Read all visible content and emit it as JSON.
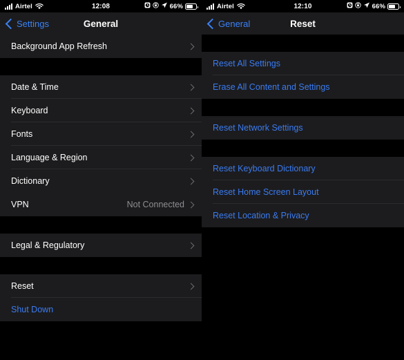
{
  "panels": [
    {
      "id": "general",
      "status_bar": {
        "carrier": "Airtel",
        "time": "12:08",
        "battery_percent": "66%",
        "signal_icon": "cellular-signal-icon",
        "wifi_icon": "wifi-icon",
        "alarm_icon": "alarm-clock-icon",
        "rotation_lock_icon": "rotation-lock-icon",
        "location_icon": "location-arrow-icon",
        "battery_icon": "battery-icon"
      },
      "nav": {
        "back_label": "Settings",
        "title": "General",
        "back_icon": "chevron-left-icon"
      },
      "groups": [
        {
          "rows": [
            {
              "label": "Background App Refresh",
              "detail": "",
              "chevron": true,
              "style": "default"
            }
          ]
        },
        {
          "rows": [
            {
              "label": "Date & Time",
              "detail": "",
              "chevron": true,
              "style": "default"
            },
            {
              "label": "Keyboard",
              "detail": "",
              "chevron": true,
              "style": "default"
            },
            {
              "label": "Fonts",
              "detail": "",
              "chevron": true,
              "style": "default"
            },
            {
              "label": "Language & Region",
              "detail": "",
              "chevron": true,
              "style": "default"
            },
            {
              "label": "Dictionary",
              "detail": "",
              "chevron": true,
              "style": "default"
            }
          ]
        },
        {
          "rows": [
            {
              "label": "VPN",
              "detail": "Not Connected",
              "chevron": true,
              "style": "default"
            }
          ]
        },
        {
          "rows": [
            {
              "label": "Legal & Regulatory",
              "detail": "",
              "chevron": true,
              "style": "default"
            }
          ]
        },
        {
          "rows": [
            {
              "label": "Reset",
              "detail": "",
              "chevron": true,
              "style": "default"
            },
            {
              "label": "Shut Down",
              "detail": "",
              "chevron": false,
              "style": "blue"
            }
          ]
        }
      ]
    },
    {
      "id": "reset",
      "status_bar": {
        "carrier": "Airtel",
        "time": "12:10",
        "battery_percent": "66%",
        "signal_icon": "cellular-signal-icon",
        "wifi_icon": "wifi-icon",
        "alarm_icon": "alarm-clock-icon",
        "rotation_lock_icon": "rotation-lock-icon",
        "location_icon": "location-arrow-icon",
        "battery_icon": "battery-icon"
      },
      "nav": {
        "back_label": "General",
        "title": "Reset",
        "back_icon": "chevron-left-icon"
      },
      "groups": [
        {
          "rows": [
            {
              "label": "Reset All Settings",
              "detail": "",
              "chevron": false,
              "style": "blue"
            },
            {
              "label": "Erase All Content and Settings",
              "detail": "",
              "chevron": false,
              "style": "blue"
            }
          ]
        },
        {
          "rows": [
            {
              "label": "Reset Network Settings",
              "detail": "",
              "chevron": false,
              "style": "blue"
            }
          ]
        },
        {
          "rows": [
            {
              "label": "Reset Keyboard Dictionary",
              "detail": "",
              "chevron": false,
              "style": "blue"
            },
            {
              "label": "Reset Home Screen Layout",
              "detail": "",
              "chevron": false,
              "style": "blue"
            },
            {
              "label": "Reset Location & Privacy",
              "detail": "",
              "chevron": false,
              "style": "blue"
            }
          ]
        }
      ]
    }
  ],
  "colors": {
    "background": "#000000",
    "cell": "#1c1c1e",
    "separator": "#2c2c2e",
    "accent_blue": "#3b7bf0",
    "nav_blue": "#3b82f6",
    "primary_text": "#ffffff",
    "secondary_text": "#8e8e93"
  },
  "layout": {
    "panel_gaps": {
      "general": [
        0,
        25,
        0,
        25,
        25,
        25,
        0
      ],
      "reset": [
        25,
        25,
        25,
        0
      ]
    }
  }
}
